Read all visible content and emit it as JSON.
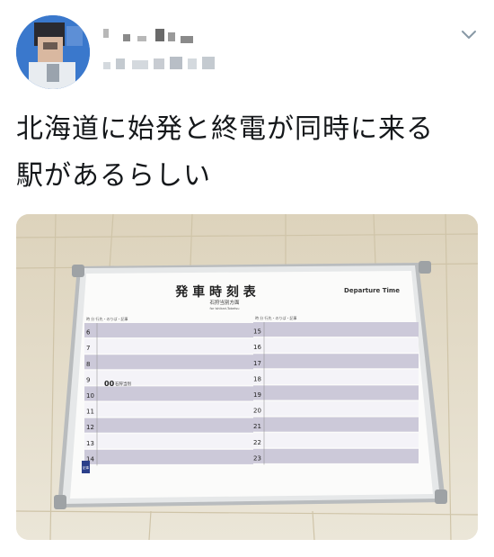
{
  "tweet": {
    "text_line1": "北海道に始発と終電が同時に来る",
    "text_line2": "駅があるらしい",
    "menu_icon": "chevron-down-icon"
  },
  "photo": {
    "board_title": "発 車 時 刻 表",
    "board_title_en": "Departure Time",
    "direction": "石狩当別方面",
    "direction_en": "for Ishikari-Tobetsu",
    "left_header": "時  分  行先・のりば・記事",
    "right_header": "時  分  行先・のりば・記事",
    "left_hours": [
      "6",
      "7",
      "8",
      "9",
      "10",
      "11",
      "12",
      "13",
      "14"
    ],
    "right_hours": [
      "15",
      "16",
      "17",
      "18",
      "19",
      "20",
      "21",
      "22",
      "23"
    ],
    "departure_minute": "00",
    "departure_dest": "石狩当別",
    "corner_label": "記事"
  }
}
